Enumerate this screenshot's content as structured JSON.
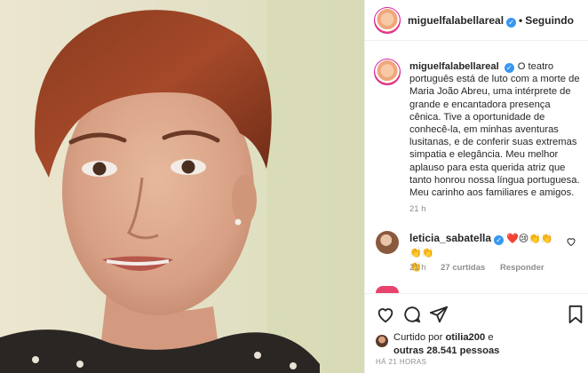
{
  "post": {
    "author": "miguelfalabellareal",
    "follow_separator": "•",
    "follow_label": "Seguindo",
    "caption": "O teatro português está de luto com a morte de Maria João Abreu, uma intérprete de grande e encantadora presença cênica. Tive a oportunidade de conhecê-la, em minhas aventuras lusitanas, e de conferir suas extremas simpatia e elegância. Meu melhor aplauso para esta querida atriz que tanto honrou nossa língua portuguesa. Meu carinho aos familiares e amigos.",
    "caption_time": "21 h",
    "verified_mark": "✓"
  },
  "comment": {
    "author": "leticia_sabatella",
    "text": "❤️😢👏👏👏👏",
    "text_line2": "👏",
    "time": "21 h",
    "likes": "27 curtidas",
    "reply_label": "Responder",
    "like_icon": "heart-outline-icon"
  },
  "actions": {
    "like_icon": "heart-outline-icon",
    "comment_icon": "comment-bubble-icon",
    "share_icon": "paper-plane-icon",
    "save_icon": "bookmark-icon"
  },
  "likes": {
    "prefix": "Curtido por",
    "first_user": "otilia200",
    "connector": "e",
    "others": "outras 28.541 pessoas"
  },
  "date": "HÁ 21 HORAS",
  "colors": {
    "verified": "#3897f0",
    "secondary_text": "#8e8e8e",
    "primary_text": "#262626",
    "story_ring": "#d6249f"
  }
}
